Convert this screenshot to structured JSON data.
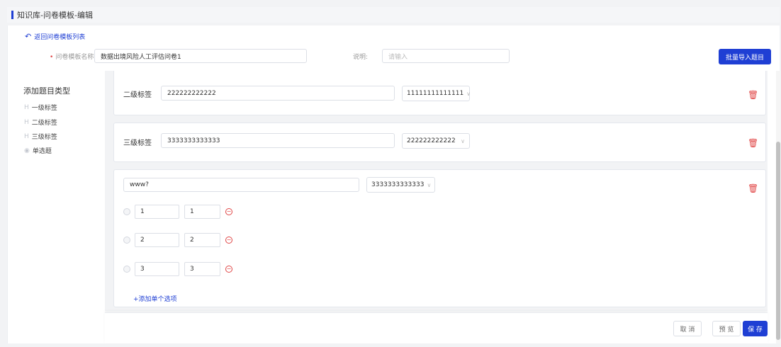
{
  "breadcrumb": "知识库-问卷模板-编辑",
  "back_label": "返回问卷模板列表",
  "template": {
    "name_label": "问卷模板名称:",
    "name_value": "数据出境风险人工评估问卷1",
    "desc_label": "说明:",
    "desc_placeholder": "请输入",
    "import_button": "批量导入题目"
  },
  "sidebar": {
    "title": "添加题目类型",
    "items": [
      {
        "icon": "H",
        "label": "一级标签"
      },
      {
        "icon": "H",
        "label": "二级标签"
      },
      {
        "icon": "H",
        "label": "三级标签"
      },
      {
        "icon": "◉",
        "label": "单选题"
      }
    ]
  },
  "cards": {
    "level2": {
      "label": "二级标签",
      "value": "222222222222",
      "select": "11111111111111"
    },
    "level3": {
      "label": "三级标签",
      "value": "3333333333333",
      "select": "222222222222"
    },
    "question": {
      "value": "www?",
      "select": "3333333333333",
      "options": [
        {
          "a": "1",
          "b": "1"
        },
        {
          "a": "2",
          "b": "2"
        },
        {
          "a": "3",
          "b": "3"
        }
      ],
      "add_option": "+添加单个选项"
    }
  },
  "footer": {
    "cancel": "取 消",
    "preview": "预 览",
    "save": "保 存"
  },
  "colors": {
    "accent": "#1f3fd4",
    "danger": "#e04545"
  }
}
